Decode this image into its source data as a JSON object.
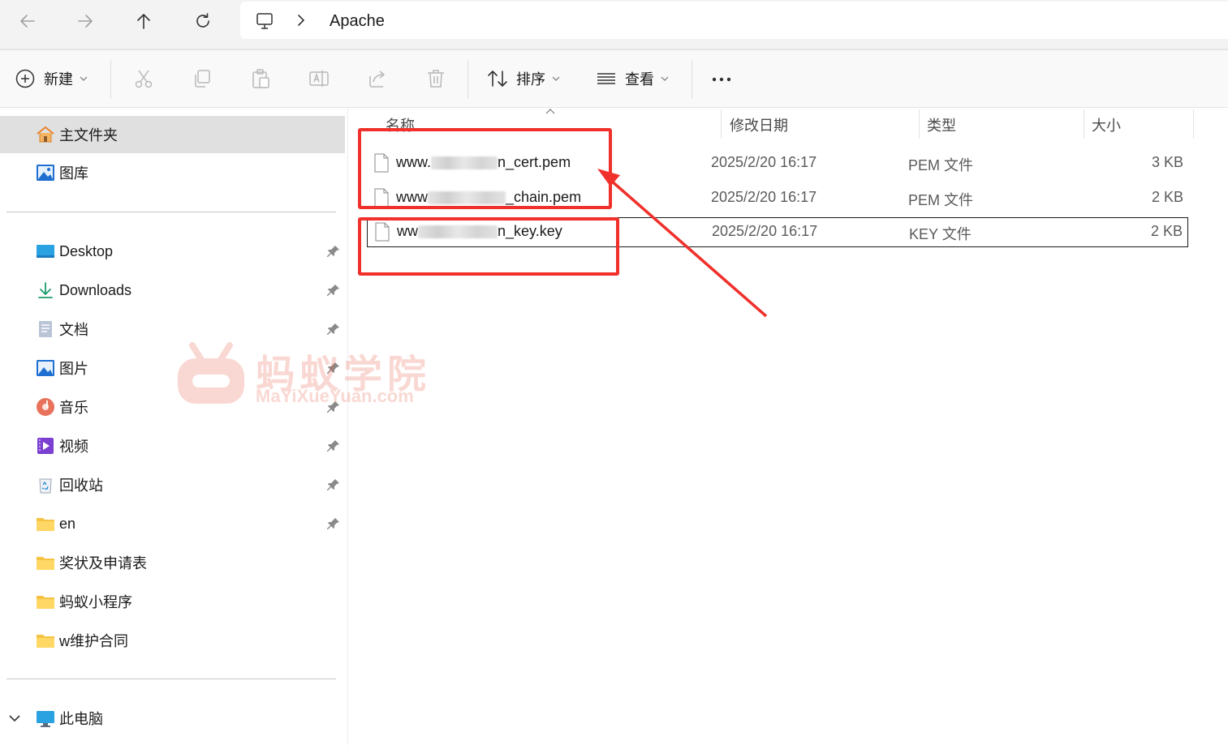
{
  "address_bar": {
    "breadcrumb": "Apache"
  },
  "toolbar": {
    "new_label": "新建",
    "sort_label": "排序",
    "view_label": "查看"
  },
  "sidebar": {
    "home": "主文件夹",
    "gallery": "图库",
    "pinned": [
      {
        "label": "Desktop",
        "icon": "desktop-icon"
      },
      {
        "label": "Downloads",
        "icon": "downloads-icon"
      },
      {
        "label": "文档",
        "icon": "documents-icon"
      },
      {
        "label": "图片",
        "icon": "pictures-icon"
      },
      {
        "label": "音乐",
        "icon": "music-icon"
      },
      {
        "label": "视频",
        "icon": "videos-icon"
      },
      {
        "label": "回收站",
        "icon": "recycle-bin-icon"
      },
      {
        "label": "en",
        "icon": "folder-icon"
      }
    ],
    "folders": [
      {
        "label": "奖状及申请表",
        "icon": "folder-icon"
      },
      {
        "label": "蚂蚁小程序",
        "icon": "folder-icon"
      },
      {
        "label": "w维护合同",
        "icon": "folder-icon"
      }
    ],
    "this_pc": "此电脑"
  },
  "columns": {
    "name": "名称",
    "date": "修改日期",
    "type": "类型",
    "size": "大小"
  },
  "files": [
    {
      "name_prefix": "www.",
      "name_suffix": "n_cert.pem",
      "date": "2025/2/20 16:17",
      "type": "PEM 文件",
      "size": "3 KB"
    },
    {
      "name_prefix": "www",
      "name_suffix": "_chain.pem",
      "date": "2025/2/20 16:17",
      "type": "PEM 文件",
      "size": "2 KB"
    },
    {
      "name_prefix": "ww",
      "name_suffix": "n_key.key",
      "date": "2025/2/20 16:17",
      "type": "KEY 文件",
      "size": "2 KB"
    }
  ],
  "watermark": {
    "title": "蚂蚁学院",
    "url": "MaYiXueYuan.com"
  },
  "colors": {
    "annotation_red": "#f0302a",
    "selected_bg": "#e0e0e0",
    "folder_yellow": "#f5c242"
  }
}
